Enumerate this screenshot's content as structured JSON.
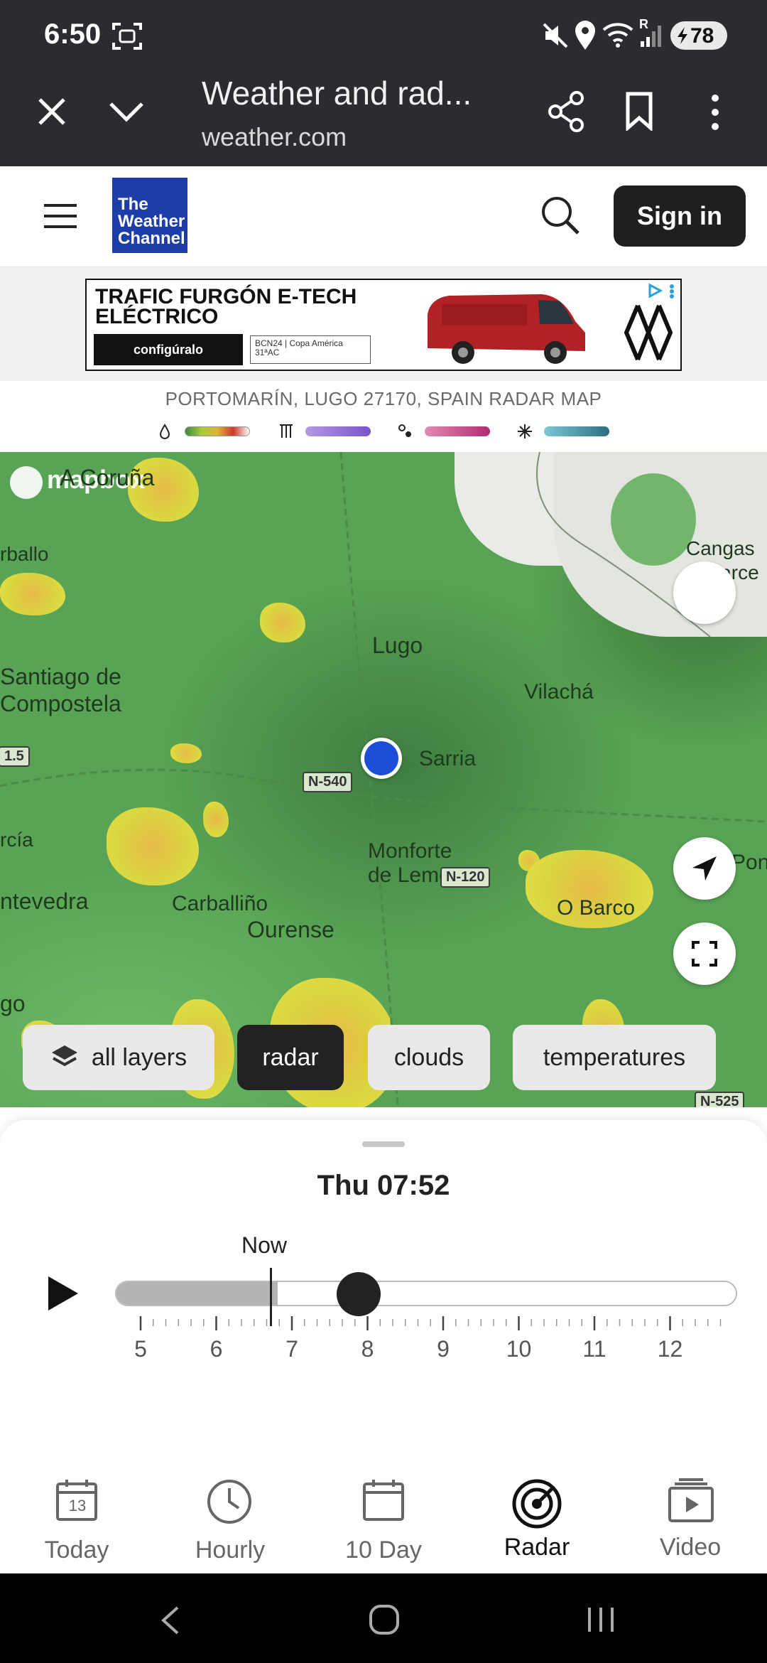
{
  "status_bar": {
    "time": "6:50",
    "battery": "78",
    "signal_label": "R"
  },
  "browser": {
    "page_title": "Weather and rad...",
    "url": "weather.com"
  },
  "site_header": {
    "logo_line1": "The",
    "logo_line2": "Weather",
    "logo_line3": "Channel",
    "sign_in": "Sign in"
  },
  "ad": {
    "headline": "TRAFIC FURGÓN E-TECH ELÉCTRICO",
    "cta": "configúralo",
    "sponsor_line1": "BCN24 | Copa América",
    "sponsor_line2": "31ªAC"
  },
  "location": {
    "title": "PORTOMARÍN, LUGO 27170, SPAIN RADAR MAP"
  },
  "legend": [
    {
      "icon": "rain-drop-icon",
      "gradient": "rain"
    },
    {
      "icon": "mix-icon",
      "gradient": "mix"
    },
    {
      "icon": "ice-icon",
      "gradient": "ice"
    },
    {
      "icon": "snow-icon",
      "gradient": "snow"
    }
  ],
  "colors": {
    "chrome": "#2b2c2f",
    "brand_blue": "#1d3ea8",
    "location_dot": "#1d4ed8",
    "map_green": "#58a355",
    "precip_yellow": "#e6e04a",
    "precip_orange": "#e7b948"
  },
  "map": {
    "attribution": "mapbox",
    "places": {
      "a_coruna": "A Coruña",
      "arballo": "rballo",
      "cangas": "Cangas",
      "narce": "Narce",
      "lugo": "Lugo",
      "santiago1": "Santiago de",
      "santiago2": "Compostela",
      "vilacha": "Vilachá",
      "sarria": "Sarria",
      "arcia": "rcía",
      "monforte1": "Monforte",
      "monforte2": "de Lemos",
      "pontevedra": "ntevedra",
      "carballino": "Carballiño",
      "ourense": "Ourense",
      "obarco": "O Barco",
      "vigo": "go",
      "ponferrada": "Ponferrad"
    },
    "roads": {
      "n540": "N-540",
      "n120": "N-120",
      "n525": "N-525",
      "r15": "1.5"
    },
    "layers": {
      "all": "all layers",
      "radar": "radar",
      "clouds": "clouds",
      "temperatures": "temperatures"
    },
    "active_layer": "radar"
  },
  "timeline": {
    "timestamp": "Thu 07:52",
    "now_label": "Now",
    "hours": [
      "5",
      "6",
      "7",
      "8",
      "9",
      "10",
      "11",
      "12"
    ],
    "progress_fraction": 0.26
  },
  "bottom_nav": {
    "items": [
      {
        "label": "Today",
        "icon": "calendar-day-icon",
        "badge": "13"
      },
      {
        "label": "Hourly",
        "icon": "clock-icon"
      },
      {
        "label": "10 Day",
        "icon": "calendar-icon"
      },
      {
        "label": "Radar",
        "icon": "radar-icon"
      },
      {
        "label": "Video",
        "icon": "video-icon"
      }
    ],
    "active": "Radar"
  }
}
